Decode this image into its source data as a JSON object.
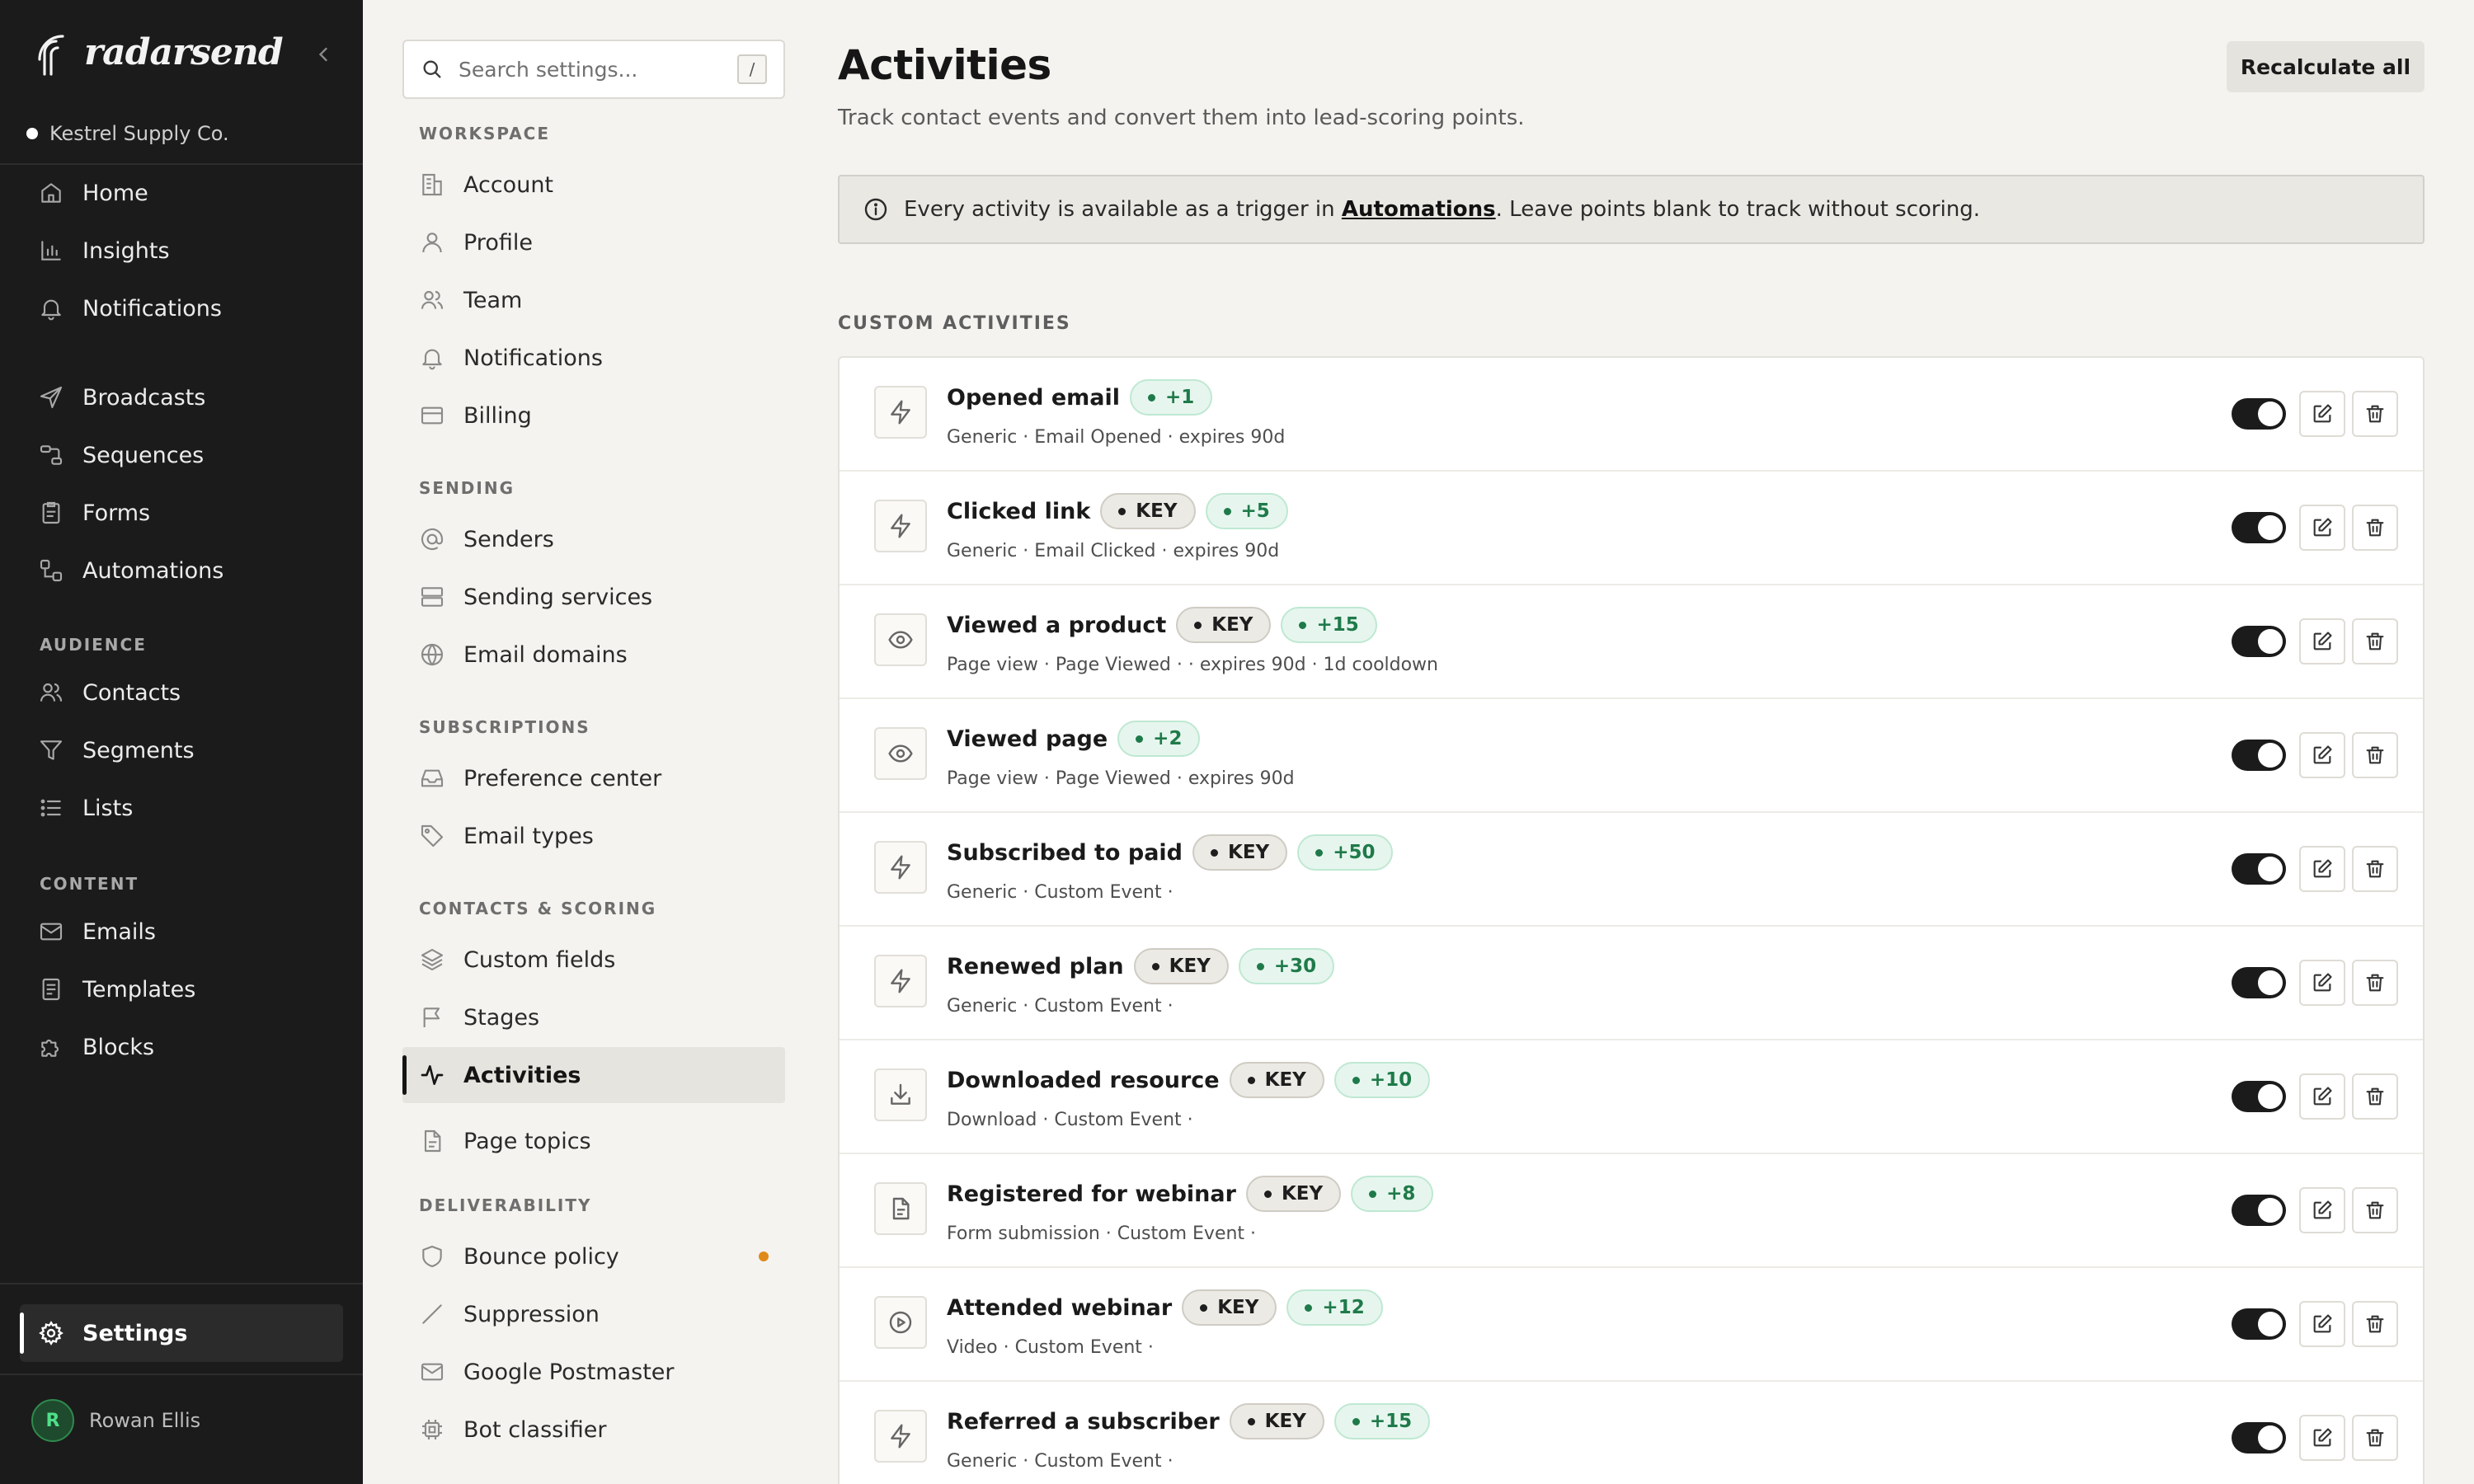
{
  "brand": {
    "name": "radarsend",
    "org": "Kestrel Supply Co."
  },
  "sidebar": {
    "main": [
      {
        "label": "Home",
        "icon": "home-icon"
      },
      {
        "label": "Insights",
        "icon": "chart-icon"
      },
      {
        "label": "Notifications",
        "icon": "bell-icon"
      }
    ],
    "send": [
      {
        "label": "Broadcasts",
        "icon": "send-icon"
      },
      {
        "label": "Sequences",
        "icon": "sequence-icon"
      },
      {
        "label": "Forms",
        "icon": "form-icon"
      },
      {
        "label": "Automations",
        "icon": "automation-icon"
      }
    ],
    "audience_label": "AUDIENCE",
    "audience": [
      {
        "label": "Contacts",
        "icon": "users-icon"
      },
      {
        "label": "Segments",
        "icon": "filter-icon"
      },
      {
        "label": "Lists",
        "icon": "list-icon"
      }
    ],
    "content_label": "CONTENT",
    "content": [
      {
        "label": "Emails",
        "icon": "mail-icon"
      },
      {
        "label": "Templates",
        "icon": "template-icon"
      },
      {
        "label": "Blocks",
        "icon": "puzzle-icon"
      }
    ],
    "settings_label": "Settings",
    "user": {
      "initial": "R",
      "name": "Rowan Ellis"
    }
  },
  "settings_nav": {
    "search_placeholder": "Search settings...",
    "search_shortcut": "/",
    "sections": {
      "workspace": "WORKSPACE",
      "sending": "SENDING",
      "subscriptions": "SUBSCRIPTIONS",
      "contacts": "CONTACTS & SCORING",
      "deliverability": "DELIVERABILITY"
    },
    "workspace": [
      "Account",
      "Profile",
      "Team",
      "Notifications",
      "Billing"
    ],
    "sending": [
      "Senders",
      "Sending services",
      "Email domains"
    ],
    "subscriptions": [
      "Preference center",
      "Email types"
    ],
    "contacts": [
      "Custom fields",
      "Stages",
      "Activities",
      "Page topics"
    ],
    "deliverability": [
      "Bounce policy",
      "Suppression",
      "Google Postmaster",
      "Bot classifier"
    ]
  },
  "main": {
    "title": "Activities",
    "subtitle": "Track contact events and convert them into lead-scoring points.",
    "recalc_label": "Recalculate all",
    "banner": {
      "before": "Every activity is available as a trigger in",
      "link": "Automations",
      "after": ". Leave points blank to track without scoring."
    },
    "list_label": "CUSTOM ACTIVITIES",
    "key_label": "KEY",
    "activities": [
      {
        "name": "Opened email",
        "key": false,
        "points": "+1",
        "meta": "Generic · Email Opened · expires 90d",
        "icon": "bolt-icon",
        "enabled": true
      },
      {
        "name": "Clicked link",
        "key": true,
        "points": "+5",
        "meta": "Generic · Email Clicked · expires 90d",
        "icon": "bolt-icon",
        "enabled": true
      },
      {
        "name": "Viewed a product",
        "key": true,
        "points": "+15",
        "meta": "Page view · Page Viewed · · expires 90d · 1d cooldown",
        "icon": "eye-icon",
        "enabled": true
      },
      {
        "name": "Viewed page",
        "key": false,
        "points": "+2",
        "meta": "Page view · Page Viewed · expires 90d",
        "icon": "eye-icon",
        "enabled": true
      },
      {
        "name": "Subscribed to paid",
        "key": true,
        "points": "+50",
        "meta": "Generic · Custom Event ·",
        "icon": "bolt-icon",
        "enabled": true
      },
      {
        "name": "Renewed plan",
        "key": true,
        "points": "+30",
        "meta": "Generic · Custom Event ·",
        "icon": "bolt-icon",
        "enabled": true
      },
      {
        "name": "Downloaded resource",
        "key": true,
        "points": "+10",
        "meta": "Download · Custom Event ·",
        "icon": "download-icon",
        "enabled": true
      },
      {
        "name": "Registered for webinar",
        "key": true,
        "points": "+8",
        "meta": "Form submission · Custom Event ·",
        "icon": "document-icon",
        "enabled": true
      },
      {
        "name": "Attended webinar",
        "key": true,
        "points": "+12",
        "meta": "Video · Custom Event ·",
        "icon": "play-icon",
        "enabled": true
      },
      {
        "name": "Referred a subscriber",
        "key": true,
        "points": "+15",
        "meta": "Generic · Custom Event ·",
        "icon": "bolt-icon",
        "enabled": true
      }
    ]
  }
}
